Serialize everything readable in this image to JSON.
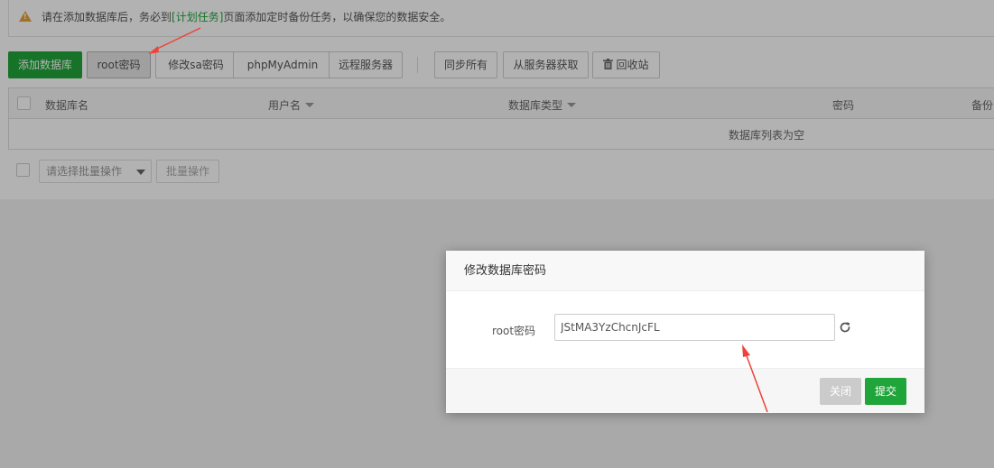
{
  "notice": {
    "text_before": "请在添加数据库后，务必到",
    "link": "[计划任务]",
    "text_after": "页面添加定时备份任务，以确保您的数据安全。"
  },
  "toolbar": {
    "add_db": "添加数据库",
    "root_pwd": "root密码",
    "sa_pwd": "修改sa密码",
    "phpmyadmin": "phpMyAdmin",
    "remote": "远程服务器",
    "sync_all": "同步所有",
    "fetch_server": "从服务器获取",
    "recycle": "回收站"
  },
  "table": {
    "columns": [
      "数据库名",
      "用户名",
      "数据库类型",
      "密码",
      "备份"
    ],
    "empty_text": "数据库列表为空"
  },
  "batch": {
    "select_placeholder": "请选择批量操作",
    "button": "批量操作"
  },
  "modal": {
    "title": "修改数据库密码",
    "field_label": "root密码",
    "field_value": "JStMA3YzChcnJcFL",
    "close": "关闭",
    "submit": "提交"
  },
  "colors": {
    "accent": "#20a53a",
    "warning": "#e8a13a",
    "arrow": "#f0413a"
  }
}
